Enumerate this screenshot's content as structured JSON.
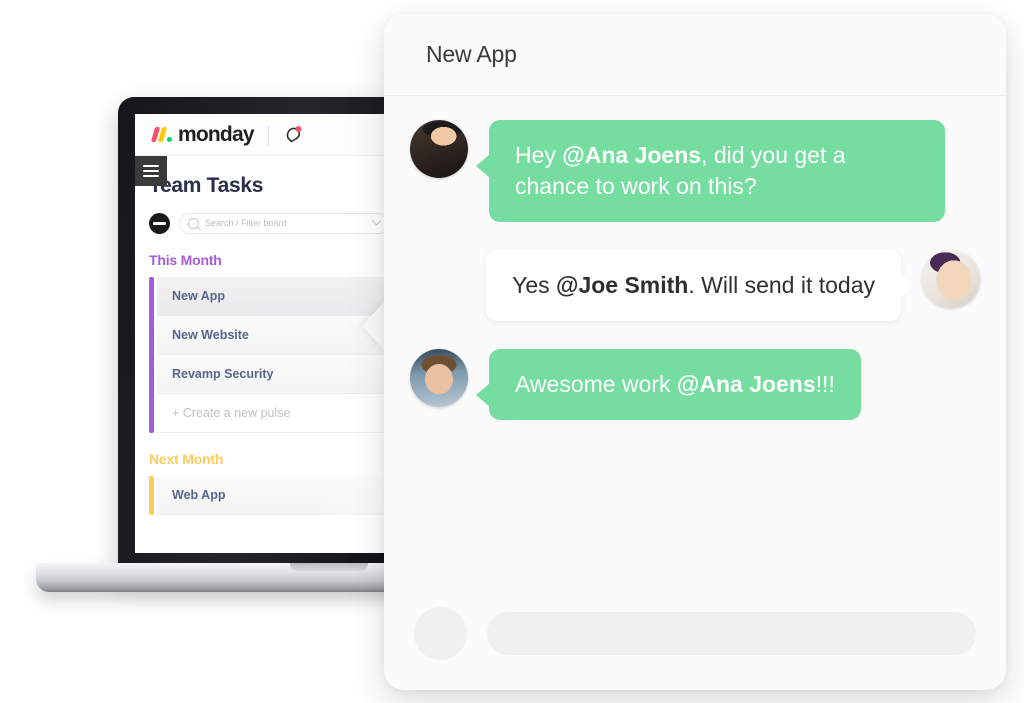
{
  "laptop": {
    "board": {
      "brand": "monday",
      "pulse_icon": "notification-pulse-icon",
      "menu_icon": "hamburger-menu-icon",
      "title": "Team Tasks",
      "search": {
        "placeholder": "Search / Filter board",
        "value": "",
        "icon": "search-icon",
        "chevron": "chevron-down-icon"
      },
      "groups": [
        {
          "name": "This Month",
          "color": "#a25ddc",
          "rows": [
            {
              "label": "New App",
              "selected": true
            },
            {
              "label": "New Website",
              "selected": false
            },
            {
              "label": "Revamp Security",
              "selected": false
            }
          ],
          "create_label": "+ Create a new pulse"
        },
        {
          "name": "Next Month",
          "color": "#fdcb5e",
          "rows": [
            {
              "label": "Web App",
              "selected": false
            }
          ],
          "create_label": ""
        }
      ]
    }
  },
  "chat": {
    "title": "New App",
    "accent_green": "#74dd9f",
    "messages": [
      {
        "side": "left",
        "style": "green",
        "avatar": "avatar-joe-smith",
        "parts": [
          {
            "text": "Hey ",
            "bold": false
          },
          {
            "text": "@Ana Joens",
            "bold": true
          },
          {
            "text": ", did you get a chance to work on this?",
            "bold": false
          }
        ]
      },
      {
        "side": "right",
        "style": "white",
        "avatar": "avatar-ana-joens",
        "parts": [
          {
            "text": "Yes ",
            "bold": false
          },
          {
            "text": "@Joe Smith",
            "bold": true
          },
          {
            "text": ". Will send it today",
            "bold": false
          }
        ]
      },
      {
        "side": "left",
        "style": "green",
        "avatar": "avatar-team-member",
        "parts": [
          {
            "text": "Awesome work ",
            "bold": false
          },
          {
            "text": "@Ana Joens",
            "bold": true
          },
          {
            "text": "!!!",
            "bold": false
          }
        ]
      }
    ],
    "composer": {
      "placeholder": "",
      "value": "",
      "avatar": "composer-avatar-placeholder"
    }
  }
}
